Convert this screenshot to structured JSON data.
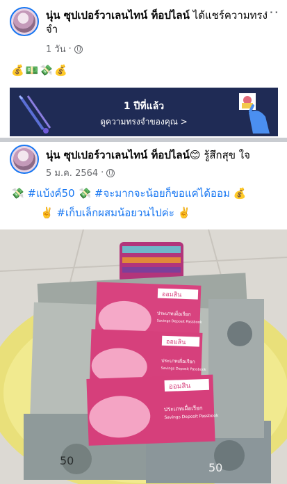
{
  "post1": {
    "author": "นุ่น ซุปเปอร์วาเลนไทน์ ท็อปไลน์",
    "action": "ได้แชร์ความทรงจำ",
    "time": "1 วัน",
    "dot": "·",
    "emoji_line": "💰💵💸💰",
    "more_label": "···"
  },
  "memory": {
    "title": "1 ปีที่แล้ว",
    "link": "ดูความทรงจำของคุณ >"
  },
  "post2": {
    "author": "นุ่น ซุปเปอร์วาเลนไทน์ ท็อปไลน์😊",
    "feeling": "รู้สึกสุข ใจ",
    "date": "5 ม.ค. 2564",
    "dot": "·",
    "line1_a": "💸",
    "line1_tag1": "#แบ้งค์50",
    "line1_b": " 💸",
    "line1_tag2": "#จะมากจะน้อยก็ขอแค่ได้ออม",
    "line1_c": "💰",
    "line2_a": "✌️ ",
    "line2_tag": "#เก็บเล็กผสมน้อยวนไปค่ะ",
    "line2_b": " ✌️"
  },
  "photo": {
    "passbook_brand": "ออมสิน",
    "passbook_type": "ประเภทเผื่อเรียก",
    "passbook_en": "Savings Deposit Passbook",
    "banknote_value": "50"
  }
}
